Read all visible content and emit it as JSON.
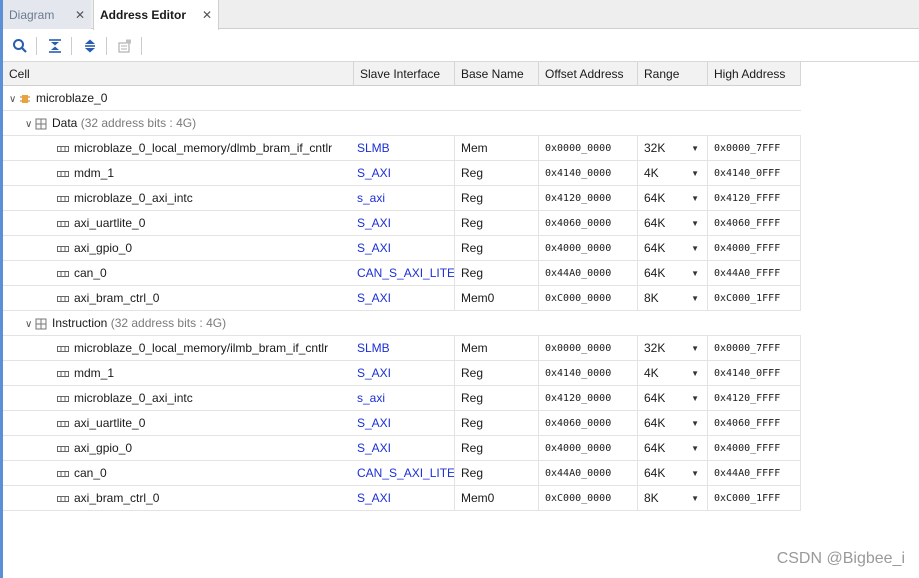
{
  "tabs": [
    {
      "label": "Diagram",
      "active": false
    },
    {
      "label": "Address Editor",
      "active": true
    }
  ],
  "toolbar": {
    "icons": [
      "search-icon",
      "collapse-all-icon",
      "expand-all-icon",
      "auto-assign-icon"
    ]
  },
  "columns": {
    "cell": "Cell",
    "slave": "Slave Interface",
    "base": "Base Name",
    "offset": "Offset Address",
    "range": "Range",
    "high": "High Address"
  },
  "root": {
    "name": "microblaze_0"
  },
  "groups": [
    {
      "name": "Data",
      "info": "(32 address bits : 4G)",
      "rows": [
        {
          "cell": "microblaze_0_local_memory/dlmb_bram_if_cntlr",
          "slave": "SLMB",
          "base": "Mem",
          "offset": "0x0000_0000",
          "range": "32K",
          "high": "0x0000_7FFF"
        },
        {
          "cell": "mdm_1",
          "slave": "S_AXI",
          "base": "Reg",
          "offset": "0x4140_0000",
          "range": "4K",
          "high": "0x4140_0FFF"
        },
        {
          "cell": "microblaze_0_axi_intc",
          "slave": "s_axi",
          "base": "Reg",
          "offset": "0x4120_0000",
          "range": "64K",
          "high": "0x4120_FFFF"
        },
        {
          "cell": "axi_uartlite_0",
          "slave": "S_AXI",
          "base": "Reg",
          "offset": "0x4060_0000",
          "range": "64K",
          "high": "0x4060_FFFF"
        },
        {
          "cell": "axi_gpio_0",
          "slave": "S_AXI",
          "base": "Reg",
          "offset": "0x4000_0000",
          "range": "64K",
          "high": "0x4000_FFFF"
        },
        {
          "cell": "can_0",
          "slave": "CAN_S_AXI_LITE",
          "base": "Reg",
          "offset": "0x44A0_0000",
          "range": "64K",
          "high": "0x44A0_FFFF"
        },
        {
          "cell": "axi_bram_ctrl_0",
          "slave": "S_AXI",
          "base": "Mem0",
          "offset": "0xC000_0000",
          "range": "8K",
          "high": "0xC000_1FFF"
        }
      ]
    },
    {
      "name": "Instruction",
      "info": "(32 address bits : 4G)",
      "rows": [
        {
          "cell": "microblaze_0_local_memory/ilmb_bram_if_cntlr",
          "slave": "SLMB",
          "base": "Mem",
          "offset": "0x0000_0000",
          "range": "32K",
          "high": "0x0000_7FFF"
        },
        {
          "cell": "mdm_1",
          "slave": "S_AXI",
          "base": "Reg",
          "offset": "0x4140_0000",
          "range": "4K",
          "high": "0x4140_0FFF"
        },
        {
          "cell": "microblaze_0_axi_intc",
          "slave": "s_axi",
          "base": "Reg",
          "offset": "0x4120_0000",
          "range": "64K",
          "high": "0x4120_FFFF"
        },
        {
          "cell": "axi_uartlite_0",
          "slave": "S_AXI",
          "base": "Reg",
          "offset": "0x4060_0000",
          "range": "64K",
          "high": "0x4060_FFFF"
        },
        {
          "cell": "axi_gpio_0",
          "slave": "S_AXI",
          "base": "Reg",
          "offset": "0x4000_0000",
          "range": "64K",
          "high": "0x4000_FFFF"
        },
        {
          "cell": "can_0",
          "slave": "CAN_S_AXI_LITE",
          "base": "Reg",
          "offset": "0x44A0_0000",
          "range": "64K",
          "high": "0x44A0_FFFF"
        },
        {
          "cell": "axi_bram_ctrl_0",
          "slave": "S_AXI",
          "base": "Mem0",
          "offset": "0xC000_0000",
          "range": "8K",
          "high": "0xC000_1FFF"
        }
      ]
    }
  ],
  "watermark": "CSDN @Bigbee_i"
}
